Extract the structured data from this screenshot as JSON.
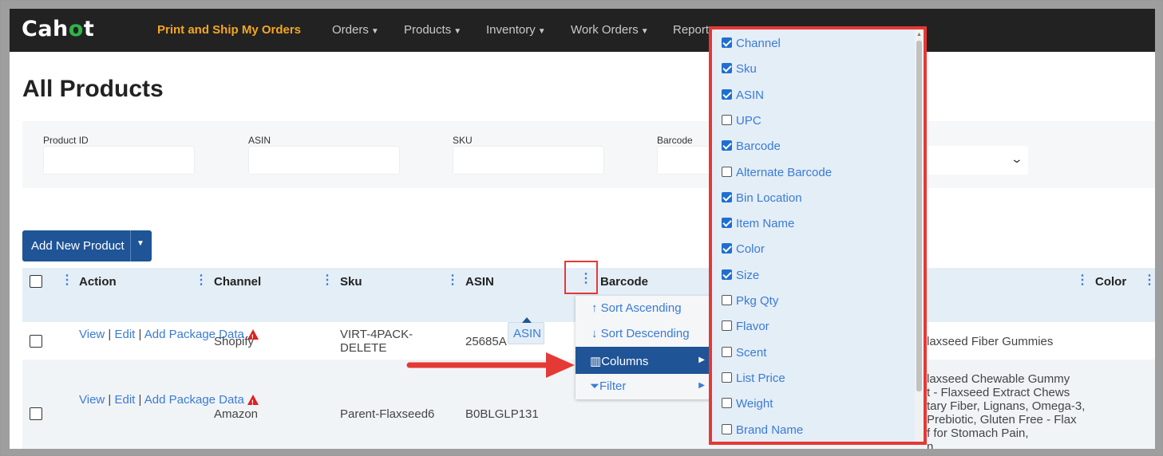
{
  "app": {
    "logo_prefix": "Cah",
    "logo_accent": "o",
    "logo_suffix": "t"
  },
  "nav": {
    "items": [
      {
        "label": "Print and Ship My Orders",
        "dropdown": false
      },
      {
        "label": "Orders",
        "dropdown": true
      },
      {
        "label": "Products",
        "dropdown": true
      },
      {
        "label": "Inventory",
        "dropdown": true
      },
      {
        "label": "Work Orders",
        "dropdown": true
      },
      {
        "label": "Report",
        "dropdown": false
      }
    ]
  },
  "page": {
    "title": "All Products"
  },
  "filters": {
    "product_id_label": "Product ID",
    "asin_label": "ASIN",
    "sku_label": "SKU",
    "barcode_label": "Barcode"
  },
  "toolbar": {
    "add_new_product_label": "Add New Product"
  },
  "table": {
    "headers": {
      "action": "Action",
      "channel": "Channel",
      "sku": "Sku",
      "asin": "ASIN",
      "barcode": "Barcode",
      "color": "Color"
    },
    "row_links": {
      "view": "View",
      "edit": "Edit",
      "add_package": "Add Package Data",
      "pipe": "|"
    },
    "rows": [
      {
        "channel": "Shopify",
        "sku": "VIRT-4PACK-DELETE",
        "asin": "25685A",
        "item_name": "laxseed Fiber Gummies"
      },
      {
        "channel": "Amazon",
        "sku": "Parent-Flaxseed6",
        "asin": "B0BLGLP131",
        "item_name_lines": [
          "laxseed Chewable Gummy",
          "t - Flaxseed Extract Chews",
          "tary Fiber, Lignans, Omega-3,",
          "Prebiotic, Gluten Free - Flax",
          "f for Stomach Pain,",
          "n"
        ]
      }
    ]
  },
  "column_menu": {
    "sort_ascending": "Sort Ascending",
    "sort_descending": "Sort Descending",
    "columns": "Columns",
    "filter": "Filter",
    "tooltip": "ASIN"
  },
  "column_chooser": [
    {
      "label": "Channel",
      "checked": true
    },
    {
      "label": "Sku",
      "checked": true
    },
    {
      "label": "ASIN",
      "checked": true
    },
    {
      "label": "UPC",
      "checked": false
    },
    {
      "label": "Barcode",
      "checked": true
    },
    {
      "label": "Alternate Barcode",
      "checked": false
    },
    {
      "label": "Bin Location",
      "checked": true
    },
    {
      "label": "Item Name",
      "checked": true
    },
    {
      "label": "Color",
      "checked": true
    },
    {
      "label": "Size",
      "checked": true
    },
    {
      "label": "Pkg Qty",
      "checked": false
    },
    {
      "label": "Flavor",
      "checked": false
    },
    {
      "label": "Scent",
      "checked": false
    },
    {
      "label": "List Price",
      "checked": false
    },
    {
      "label": "Weight",
      "checked": false
    },
    {
      "label": "Brand Name",
      "checked": false
    }
  ]
}
